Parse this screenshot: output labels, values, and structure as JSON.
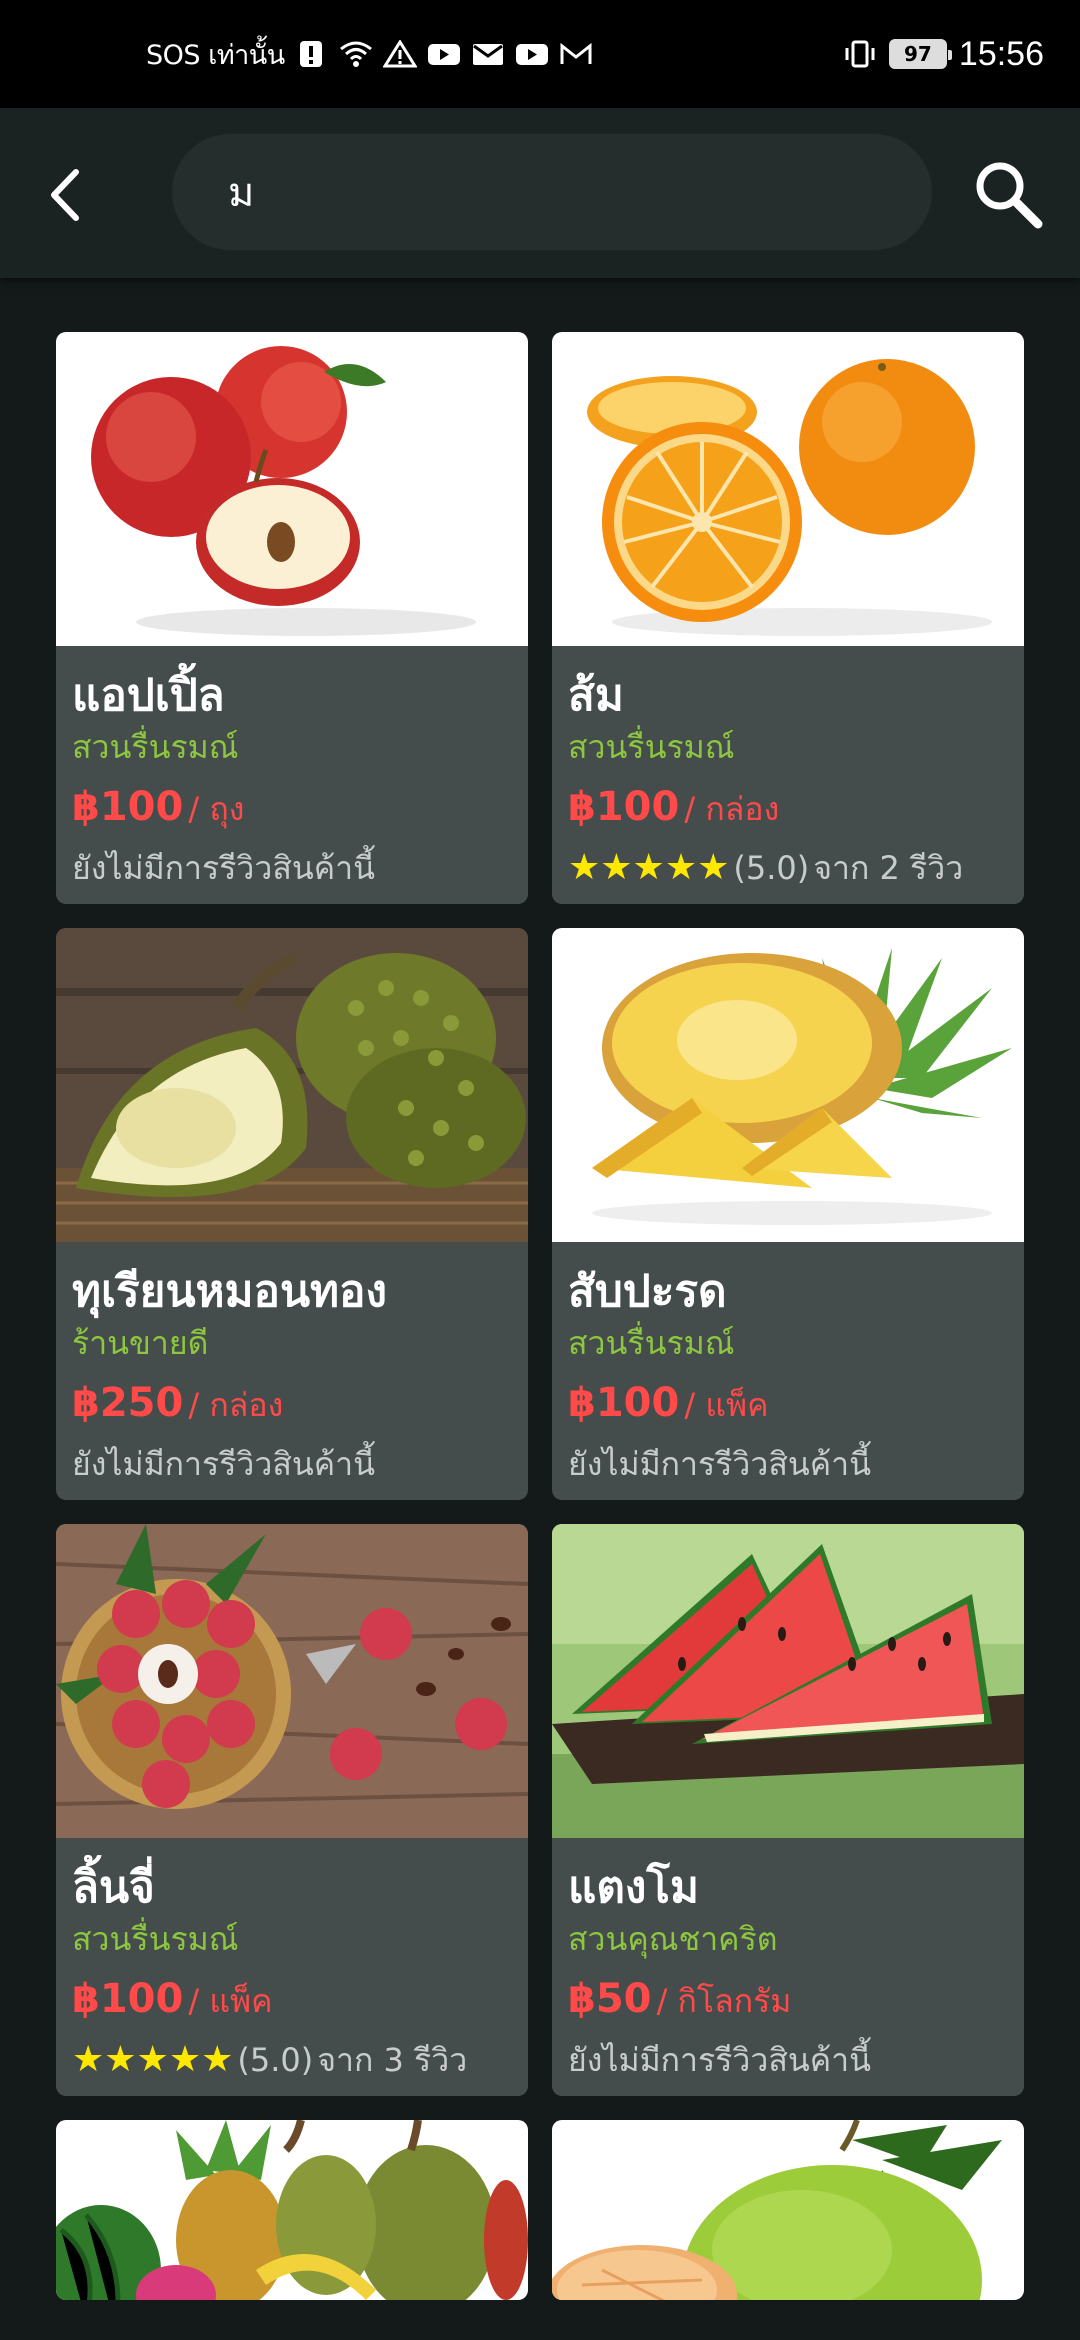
{
  "status_bar": {
    "sos_text": "SOS เท่านั้น",
    "battery": "97",
    "time": "15:56"
  },
  "header": {
    "search_value": "ม",
    "back_icon": "chevron-left-icon",
    "search_icon": "search-icon"
  },
  "colors": {
    "background": "#141a1a",
    "card": "#454c4c",
    "shop_green": "#8dc63f",
    "price_red": "#ff4a4a",
    "star_yellow": "#ffe800"
  },
  "products": [
    {
      "name": "แอปเปิ้ล",
      "shop": "สวนรื่นรมณ์",
      "price": "฿100",
      "unit": "/ ถุง",
      "review_text": "ยังไม่มีการรีวิวสินค้านี้",
      "stars": "",
      "rating": "",
      "review_count": ""
    },
    {
      "name": "ส้ม",
      "shop": "สวนรื่นรมณ์",
      "price": "฿100",
      "unit": "/ กล่อง",
      "review_text": "",
      "stars": "★★★★★",
      "rating": "(5.0)",
      "review_count": "จาก 2 รีวิว"
    },
    {
      "name": "ทุเรียนหมอนทอง",
      "shop": "ร้านขายดี",
      "price": "฿250",
      "unit": "/ กล่อง",
      "review_text": "ยังไม่มีการรีวิวสินค้านี้",
      "stars": "",
      "rating": "",
      "review_count": ""
    },
    {
      "name": "สับปะรด",
      "shop": "สวนรื่นรมณ์",
      "price": "฿100",
      "unit": "/ แพ็ค",
      "review_text": "ยังไม่มีการรีวิวสินค้านี้",
      "stars": "",
      "rating": "",
      "review_count": ""
    },
    {
      "name": "ลิ้นจี่",
      "shop": "สวนรื่นรมณ์",
      "price": "฿100",
      "unit": "/ แพ็ค",
      "review_text": "",
      "stars": "★★★★★",
      "rating": "(5.0)",
      "review_count": "จาก 3 รีวิว"
    },
    {
      "name": "แตงโม",
      "shop": "สวนคุณชาคริต",
      "price": "฿50",
      "unit": "/ กิโลกรัม",
      "review_text": "ยังไม่มีการรีวิวสินค้านี้",
      "stars": "",
      "rating": "",
      "review_count": ""
    }
  ]
}
